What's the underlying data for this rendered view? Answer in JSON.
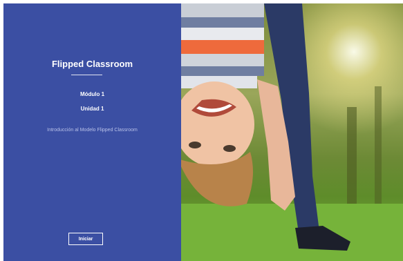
{
  "panel": {
    "title": "Flipped Classroom",
    "module": "Módulo 1",
    "unit": "Unidad 1",
    "intro": "Introducción al Modelo Flipped Classroom",
    "start_label": "Iniciar"
  },
  "colors": {
    "panel_bg": "#3b4fa3",
    "text": "#ffffff",
    "intro_text": "#b8c1e8"
  },
  "image": {
    "alt_icon": "child-upside-down-photo"
  }
}
